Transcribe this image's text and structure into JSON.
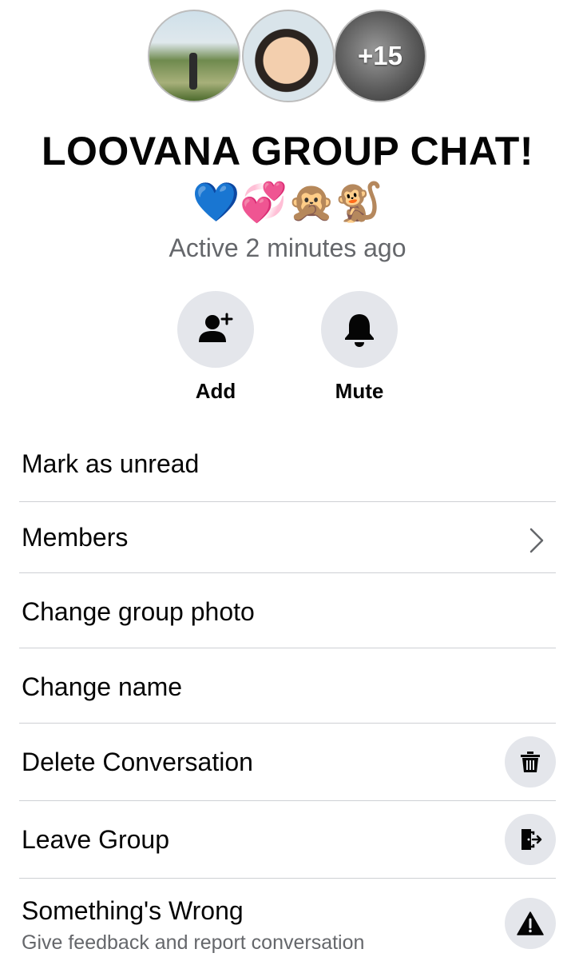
{
  "header": {
    "avatars": [
      {
        "name": "member-photo-1"
      },
      {
        "name": "member-photo-2"
      },
      {
        "name": "member-photo-3",
        "overflow_count": "+15"
      }
    ],
    "group_title": "LOOVANA GROUP CHAT!",
    "emojis": "💙💞🙊🐒",
    "status": "Active 2 minutes ago"
  },
  "actions": [
    {
      "label": "Add",
      "icon": "add-person-icon"
    },
    {
      "label": "Mute",
      "icon": "bell-icon"
    }
  ],
  "menu": {
    "mark_unread": "Mark as unread",
    "members": "Members",
    "change_photo": "Change group photo",
    "change_name": "Change name",
    "delete_conversation": "Delete Conversation",
    "leave_group": "Leave Group",
    "something_wrong": "Something's Wrong",
    "something_wrong_sub": "Give feedback and report conversation"
  },
  "icons": {
    "members": "chevron-right-icon",
    "delete": "trash-icon",
    "leave": "exit-door-icon",
    "report": "warning-icon"
  },
  "colors": {
    "icon_bg": "#e4e6eb",
    "secondary_text": "#65676b",
    "divider": "#ced0d4"
  }
}
